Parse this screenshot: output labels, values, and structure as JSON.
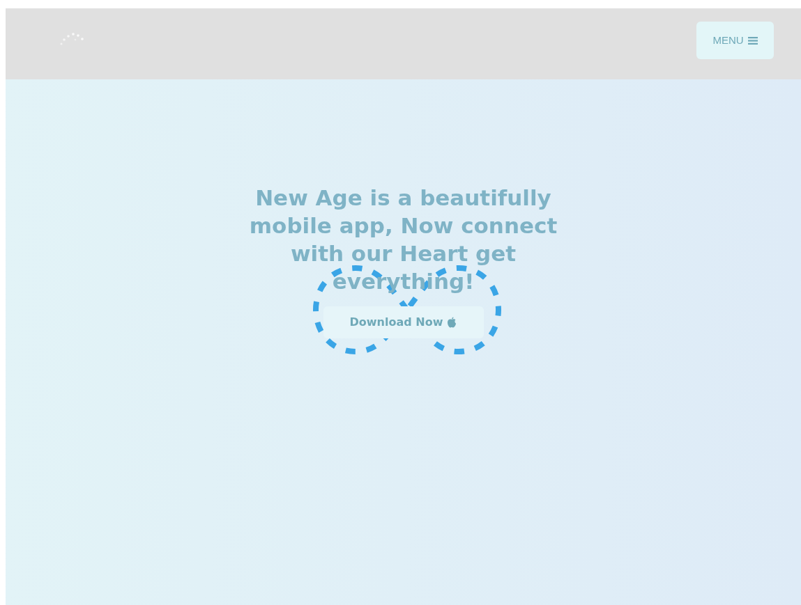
{
  "header": {
    "menu_button": {
      "label": "MENU"
    }
  },
  "hero": {
    "heading": "New Age is a beautifully mobile app, Now connect with our Heart get everything!",
    "button": {
      "label": "Download Now"
    }
  }
}
